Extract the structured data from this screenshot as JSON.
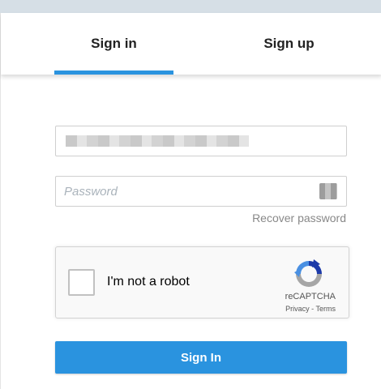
{
  "tabs": {
    "signin_label": "Sign in",
    "signup_label": "Sign up",
    "active": "signin"
  },
  "form": {
    "password_placeholder": "Password",
    "recover_label": "Recover password",
    "submit_label": "Sign In"
  },
  "captcha": {
    "label": "I'm not a robot",
    "brand": "reCAPTCHA",
    "privacy_label": "Privacy",
    "separator": " - ",
    "terms_label": "Terms",
    "icon": "recaptcha-logo-icon"
  },
  "colors": {
    "accent": "#2a93df",
    "top_strip": "#d6dfe6"
  }
}
